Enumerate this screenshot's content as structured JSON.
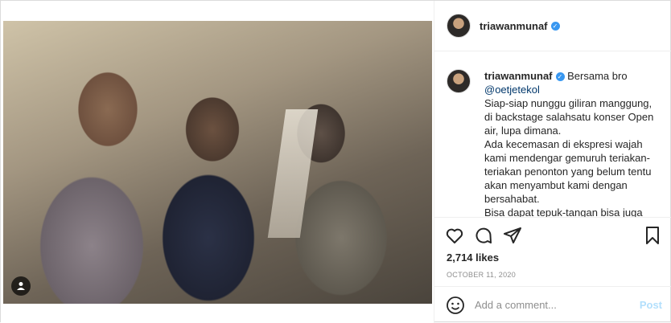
{
  "post": {
    "username": "triawanmunaf",
    "verified_icon": "verified-badge-icon",
    "caption_lines": [
      "Siap-siap nunggu giliran manggung, di backstage salahsatu konser Open air, lupa dimana.",
      "Ada kecemasan di ekspresi wajah kami mendengar gemuruh teriakan-teriakan penonton yang belum tentu akan menyambut kami dengan bersahabat.",
      "Bisa dapat tepuk-tangan bisa juga"
    ],
    "caption_intro": "Bersama bro",
    "mention": "@oetjetekol",
    "likes": "2,714 likes",
    "date": "OCTOBER 11, 2020",
    "comment_placeholder": "Add a comment...",
    "post_button": "Post"
  },
  "colors": {
    "verified": "#3897f0",
    "post_button_disabled": "#b2dffc",
    "mention": "#00376b"
  },
  "icons": [
    "heart-icon",
    "comment-icon",
    "share-icon",
    "bookmark-icon",
    "emoji-icon",
    "user-tag-icon"
  ]
}
